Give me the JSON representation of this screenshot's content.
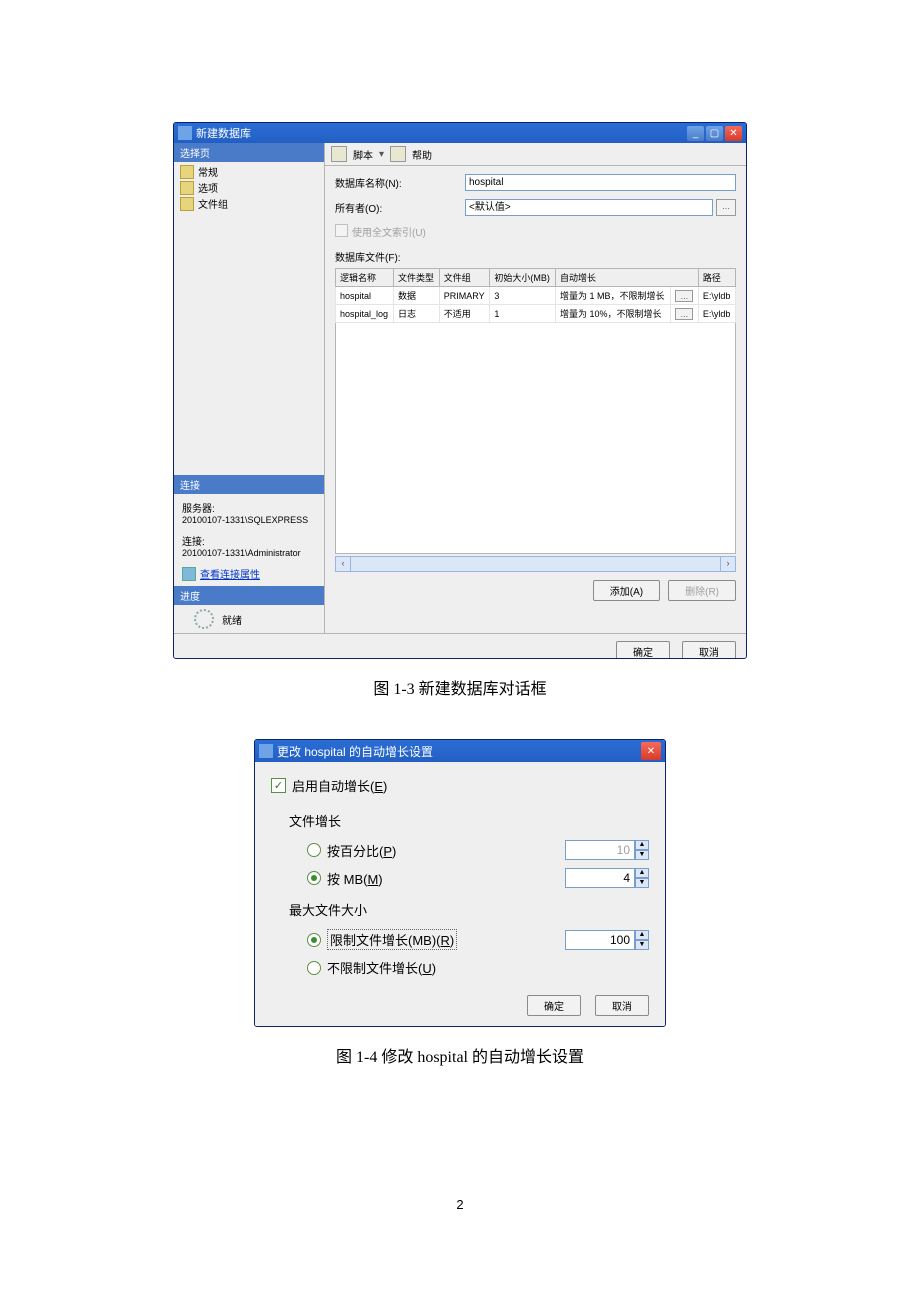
{
  "dlg1": {
    "title": "新建数据库",
    "left": {
      "select_pages": "选择页",
      "items": [
        "常规",
        "选项",
        "文件组"
      ],
      "connection_header": "连接",
      "server_label": "服务器:",
      "server_value": "20100107-1331\\SQLEXPRESS",
      "conn_label": "连接:",
      "conn_value": "20100107-1331\\Administrator",
      "view_conn_props": "查看连接属性",
      "progress_header": "进度",
      "ready": "就绪"
    },
    "toolbar": {
      "script": "脚本",
      "help": "帮助"
    },
    "form": {
      "db_name_label": "数据库名称(N):",
      "db_name_value": "hospital",
      "owner_label": "所有者(O):",
      "owner_value": "<默认值>",
      "fulltext_label": "使用全文索引(U)",
      "files_label": "数据库文件(F):"
    },
    "grid": {
      "cols": [
        "逻辑名称",
        "文件类型",
        "文件组",
        "初始大小(MB)",
        "自动增长",
        "路径"
      ],
      "rows": [
        {
          "name": "hospital",
          "type": "数据",
          "group": "PRIMARY",
          "size": "3",
          "growth": "增量为 1 MB，不限制增长",
          "path": "E:\\yldb"
        },
        {
          "name": "hospital_log",
          "type": "日志",
          "group": "不适用",
          "size": "1",
          "growth": "增量为 10%，不限制增长",
          "path": "E:\\yldb"
        }
      ]
    },
    "btns": {
      "add": "添加(A)",
      "del": "删除(R)",
      "ok": "确定",
      "cancel": "取消"
    }
  },
  "caption1": "图 1-3 新建数据库对话框",
  "dlg2": {
    "title": "更改 hospital 的自动增长设置",
    "enable": "启用自动增长(E)",
    "filegrowth": "文件增长",
    "by_percent": "按百分比(P)",
    "by_mb": "按 MB(M)",
    "percent_val": "10",
    "mb_val": "4",
    "maxsize": "最大文件大小",
    "limit": "限制文件增长(MB)(R)",
    "unlimit": "不限制文件增长(U)",
    "limit_val": "100",
    "ok": "确定",
    "cancel": "取消"
  },
  "caption2": "图 1-4 修改 hospital 的自动增长设置",
  "page_number": "2"
}
